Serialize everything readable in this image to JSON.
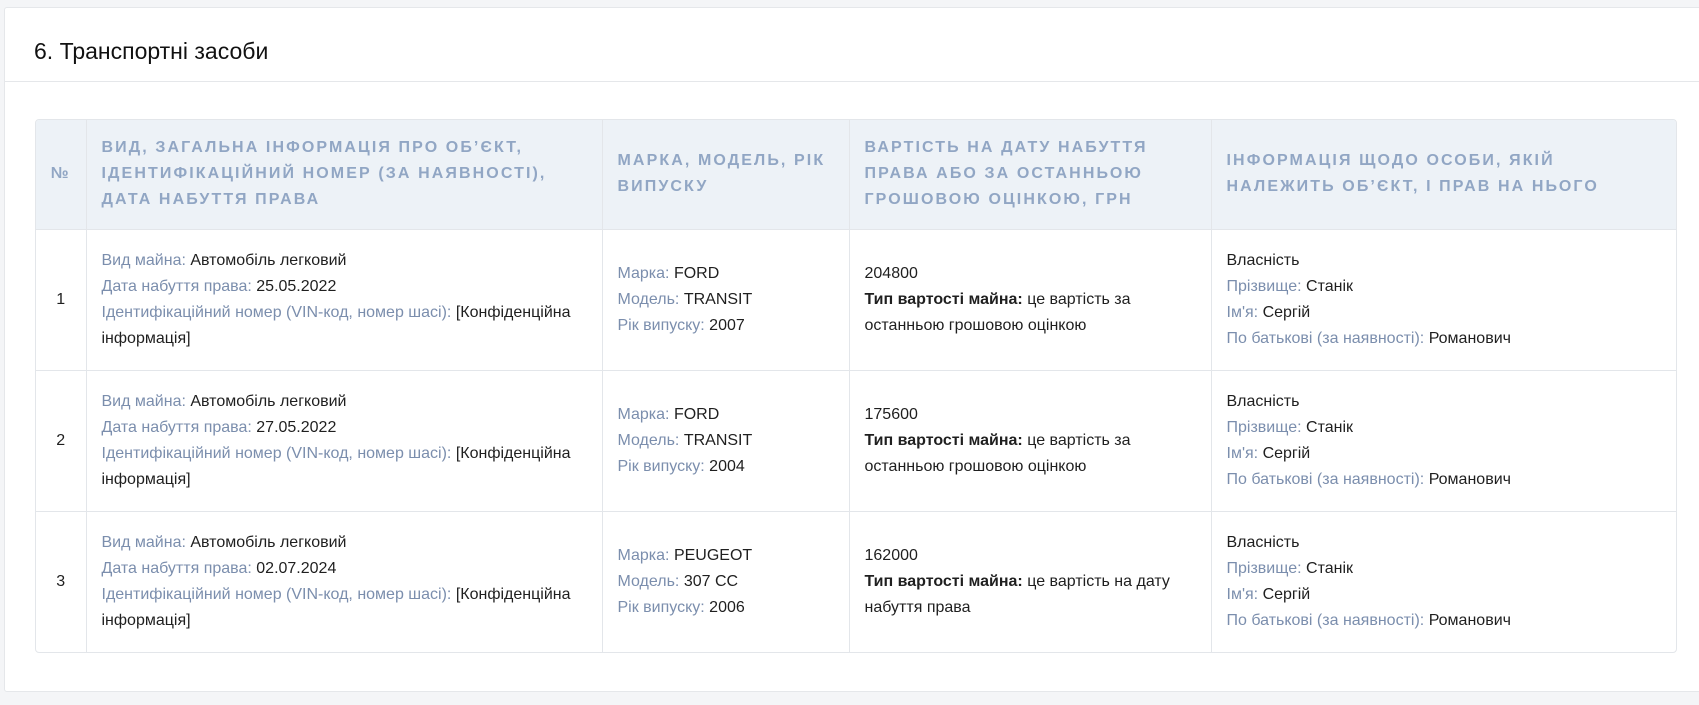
{
  "section": {
    "title": "6. Транспортні засоби"
  },
  "table": {
    "headers": {
      "num": "№",
      "general": "Вид, загальна інформація про об’єкт, ідентифікаційний номер (за наявності), дата набуття права",
      "brand": "Марка, модель, рік випуску",
      "value": "Вартість на дату набуття права або за останньою грошовою оцінкою, грн",
      "owner": "Інформація щодо особи, якій належить об’єкт, і прав на нього"
    },
    "labels": {
      "kind": "Вид майна:",
      "date": "Дата набуття права:",
      "vin": "Ідентифікаційний номер (VIN-код, номер шасі):",
      "make": "Марка:",
      "model": "Модель:",
      "year": "Рік випуску:",
      "value_type": "Тип вартості майна:",
      "surname": "Прізвище:",
      "name": "Ім'я:",
      "patronymic": "По батькові (за наявності):"
    },
    "rows": [
      {
        "num": "1",
        "kind": "Автомобіль легковий",
        "date": "25.05.2022",
        "vin": "[Конфіденційна інформація]",
        "make": "FORD",
        "model": "TRANSIT",
        "year": "2007",
        "value": "204800",
        "value_type": "це вартість за останньою грошовою оцінкою",
        "right": "Власність",
        "surname": "Станік",
        "name": "Сергій",
        "patronymic": "Романович"
      },
      {
        "num": "2",
        "kind": "Автомобіль легковий",
        "date": "27.05.2022",
        "vin": "[Конфіденційна інформація]",
        "make": "FORD",
        "model": "TRANSIT",
        "year": "2004",
        "value": "175600",
        "value_type": "це вартість за останньою грошовою оцінкою",
        "right": "Власність",
        "surname": "Станік",
        "name": "Сергій",
        "patronymic": "Романович"
      },
      {
        "num": "3",
        "kind": "Автомобіль легковий",
        "date": "02.07.2024",
        "vin": "[Конфіденційна інформація]",
        "make": "PEUGEOT",
        "model": "307 CC",
        "year": "2006",
        "value": "162000",
        "value_type": "це вартість на дату набуття права",
        "right": "Власність",
        "surname": "Станік",
        "name": "Сергій",
        "patronymic": "Романович"
      }
    ]
  }
}
